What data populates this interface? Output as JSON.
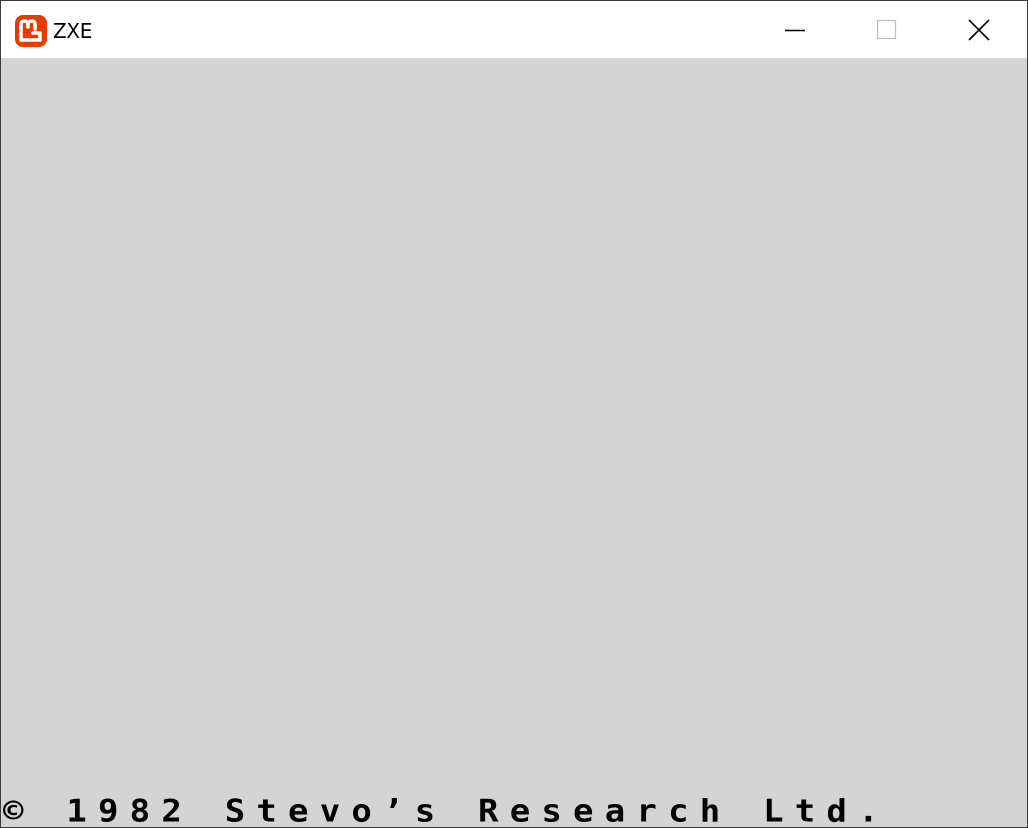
{
  "window": {
    "title": "ZXE",
    "icon": "monogame-logo-icon",
    "controls": {
      "minimize": "minimize-icon",
      "maximize": "maximize-icon",
      "close": "close-icon"
    }
  },
  "screen": {
    "background": "#d4d4d4",
    "ink": "#000000",
    "copyright_line": "© 1982 Stevo’s Research Ltd."
  },
  "colors": {
    "icon_accent": "#e73c00"
  }
}
